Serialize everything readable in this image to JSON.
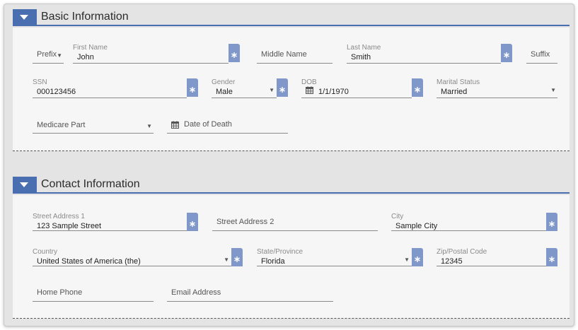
{
  "accent_color": "#4a6fb0",
  "basic": {
    "title": "Basic Information",
    "fields": {
      "prefix": {
        "placeholder": "Prefix"
      },
      "first_name": {
        "label": "First Name",
        "value": "John"
      },
      "middle_name": {
        "placeholder": "Middle Name"
      },
      "last_name": {
        "label": "Last Name",
        "value": "Smith"
      },
      "suffix": {
        "placeholder": "Suffix"
      },
      "ssn": {
        "label": "SSN",
        "value": "000123456"
      },
      "gender": {
        "label": "Gender",
        "value": "Male"
      },
      "dob": {
        "label": "DOB",
        "value": "1/1/1970"
      },
      "marital_status": {
        "label": "Marital Status",
        "value": "Married"
      },
      "medicare_part": {
        "placeholder": "Medicare Part"
      },
      "date_of_death": {
        "placeholder": "Date of Death"
      }
    }
  },
  "contact": {
    "title": "Contact Information",
    "fields": {
      "street1": {
        "label": "Street Address 1",
        "value": "123 Sample Street"
      },
      "street2": {
        "placeholder": "Street Address 2"
      },
      "city": {
        "label": "City",
        "value": "Sample City"
      },
      "country": {
        "label": "Country",
        "value": "United States of America (the)"
      },
      "state": {
        "label": "State/Province",
        "value": "Florida"
      },
      "zip": {
        "label": "Zip/Postal Code",
        "value": "12345"
      },
      "home_phone": {
        "placeholder": "Home Phone"
      },
      "email": {
        "placeholder": "Email Address"
      }
    }
  }
}
